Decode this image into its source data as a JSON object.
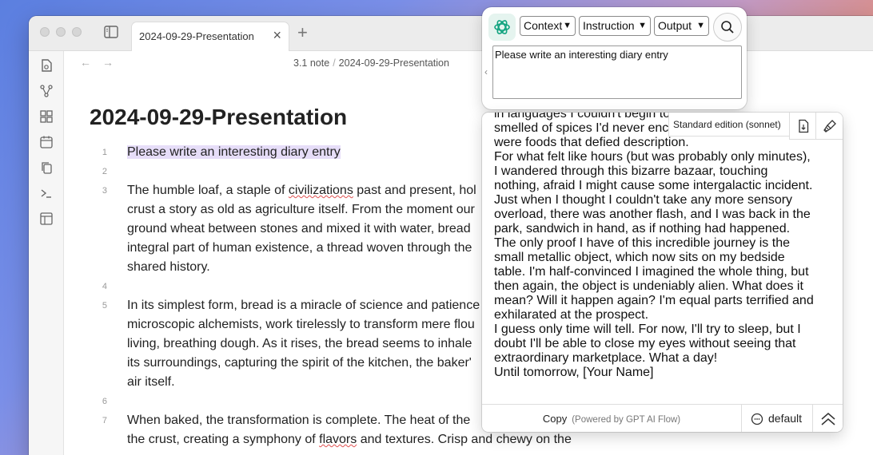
{
  "window": {
    "tab_title": "2024-09-29-Presentation",
    "tab_close": "×",
    "tab_add": "+"
  },
  "nav": {
    "back": "←",
    "forward": "→",
    "breadcrumb": [
      "3.1 note",
      "2024-09-29-Presentation"
    ],
    "separator": "/"
  },
  "note": {
    "title": "2024-09-29-Presentation",
    "line_numbers": [
      "1",
      "2",
      "3",
      "4",
      "5",
      "6",
      "7"
    ],
    "p1": "Please write an interesting diary entry",
    "p3_lines": [
      [
        "The humble loaf, a staple of ",
        "civilizations",
        " past and present, hol"
      ],
      [
        "crust a story as old as agriculture itself. From the moment our"
      ],
      [
        "ground wheat between stones and mixed it with water, bread"
      ],
      [
        "integral part of human existence, a thread woven through the"
      ],
      [
        "shared history."
      ]
    ],
    "p5_lines": [
      "In its simplest form, bread is a miracle of science and patience",
      "microscopic alchemists, work tirelessly to transform mere flou",
      "living, breathing dough. As it rises, the bread seems to inhale",
      "its surroundings, capturing the spirit of the kitchen, the baker'",
      "air itself."
    ],
    "p7_lines": [
      [
        "When baked, the transformation is complete. The heat of the"
      ],
      [
        "the crust, creating a symphony of ",
        "flavors",
        " and textures. Crisp and chewy on the"
      ]
    ]
  },
  "gpt_popup": {
    "selects": [
      "Context",
      "Instruction",
      "Output"
    ],
    "prompt": "Please write an interesting diary entry",
    "collapse_arrow": "‹"
  },
  "gpt_output": {
    "edition": "Standard edition (sonnet)",
    "text": "in languages I couldn't begin to\nsmelled of spices I'd never enc\nwere foods that defied description.\nFor what felt like hours (but was probably only minutes), I wandered through this bizarre bazaar, touching nothing, afraid I might cause some intergalactic incident. Just when I thought I couldn't take any more sensory overload, there was another flash, and I was back in the park, sandwich in hand, as if nothing had happened.\nThe only proof I have of this incredible journey is the small metallic object, which now sits on my bedside table. I'm half-convinced I imagined the whole thing, but then again, the object is undeniably alien. What does it mean? Will it happen again? I'm equal parts terrified and exhilarated at the prospect.\nI guess only time will tell. For now, I'll try to sleep, but I doubt I'll be able to close my eyes without seeing that extraordinary marketplace. What a day!\nUntil tomorrow, [Your Name]",
    "copy_label": "Copy",
    "powered_by": "(Powered by GPT AI Flow)",
    "mode_label": "default"
  },
  "colors": {
    "highlight": "#e6ddf8",
    "gpt_green": "#10a37f"
  }
}
